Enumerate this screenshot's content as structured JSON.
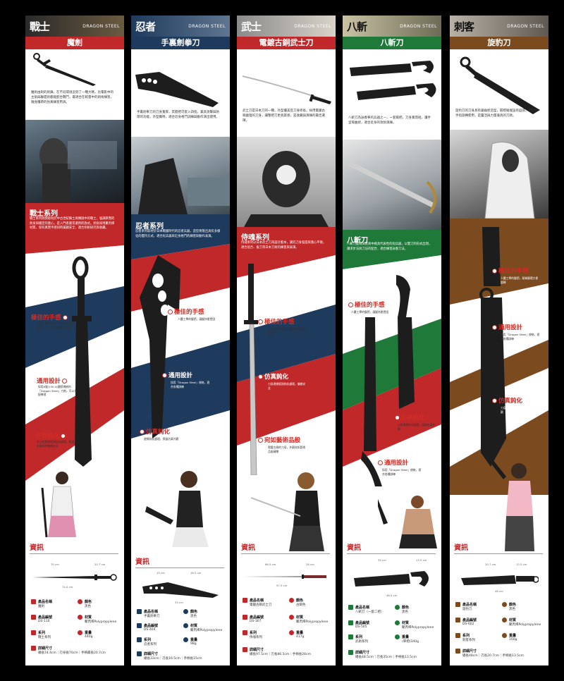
{
  "panels": [
    {
      "logo": "戰士",
      "brand": "DRAGON STEEL",
      "title": "魔劍",
      "color": "#c0282a",
      "desc": "魔劍由刺的劍鋒，在不同環境追到了一種大略，比電影中的主角與聯盟劍都能配合戰鬥，最適合在較量中的劍術練習，隨身攜帶的仿真練習用具。",
      "series": "戰士系列",
      "series_desc": "戰士系列劍款取材於中古世紀騎士與傳說中的戰士，強調厚實的劍身與穩定的重心，是入門者最常選用的款式。劍身採用聚丙烯材質，保有真實手感同時兼顧安全，適合劍術研究與收藏。",
      "features": [
        "極佳的手感",
        "通用設計",
        "仿真鈍化"
      ],
      "feature_desc": [
        "人體工學的握把，除了增強把握時的手感，更讓訓練更為舒適",
        "採用8號(130.4)國際規格的「Dragon Steel」刀劍，可以搭配練習",
        "本刀劍邊緣經過鈍化處理，保留外觀同時兼顧安全"
      ],
      "info": "資訊",
      "dims": [
        "70 cm",
        "20.7 cm",
        "74.4 cm"
      ],
      "spec_labels": [
        "產品名稱",
        "顏色",
        "產品編號",
        "材質",
        "系列",
        "重量",
        "詳細尺寸"
      ],
      "spec_values": [
        "魔劍",
        "黑色",
        "DS-110",
        "聚丙烯Polypropylene",
        "戰士系列",
        "440g",
        "總長74.4cm｜刃身長70cm｜手柄最長20.7cm"
      ]
    },
    {
      "logo": "忍者",
      "brand": "DRAGON STEEL",
      "title": "手裏劍拳刀",
      "color": "#1e3a5c",
      "desc": "手裏劍拳刀的刀身寬厚，其握把可套入四指，兼具攻擊與防禦的功能，外型獨特，適合近身格鬥訓練與動作演出使用。",
      "series": "忍者系列",
      "series_desc": "忍者系列取材於日本戰國時代的忍者兵器，造型俐落且具有多樣化的握持方式，適合短兵器與近身格鬥的練習與動作表演。",
      "features": [
        "極佳的手感",
        "通用設計",
        "仿真鈍化"
      ],
      "feature_desc": [
        "人體工學的握把，讓握持更穩固",
        "採用「Dragon Steel」規格，適合各種訓練",
        "邊緣鈍化處理，保留仿真外觀"
      ],
      "info": "資訊",
      "dims": [
        "15 cm",
        "16.5 cm",
        "33 cm"
      ],
      "spec_labels": [
        "產品名稱",
        "顏色",
        "產品編號",
        "材質",
        "系列",
        "重量",
        "詳細尺寸"
      ],
      "spec_values": [
        "手裏劍拳刀",
        "黑色",
        "DS-404",
        "聚丙烯Polypropylene",
        "忍者系列",
        "98g",
        "總長33cm｜刃長16.5cm｜手柄長15cm"
      ]
    },
    {
      "logo": "武士",
      "brand": "DRAGON STEEL",
      "title": "電鍍古銅武士刀",
      "color": "#c0282a",
      "desc": "武士刀是日本刀的一種，外型優美且刀身修長，採用電鍍古銅處理的刀身，讓整把刀更具質感，是收藏與演練的最佳選擇。",
      "series": "侍魂系列",
      "series_desc": "侍魂系列以日本武士刀為設計藍本，講究刀身弧度與重心平衡，適合居合、拔刀等日本刀術的練習與表演。",
      "features": [
        "極佳的手感",
        "仿真鈍化",
        "宛如藝術品般"
      ],
      "feature_desc": [
        "人體工學的握把，搭配纏繩手感更佳",
        "刀身邊緣經過鈍化處理，兼顧安全",
        "電鍍古銅的刀身，外觀宛如藝術品般精緻"
      ],
      "info": "資訊",
      "dims": [
        "86.5 cm",
        "26 cm",
        "97.5 cm"
      ],
      "spec_labels": [
        "產品名稱",
        "顏色",
        "產品編號",
        "材質",
        "系列",
        "重量",
        "詳細尺寸"
      ],
      "spec_values": [
        "電鍍古銅武士刀",
        "古銅色",
        "DS-307",
        "聚丙烯Polypropylene",
        "侍魂系列",
        "417g",
        "總長97.5cm｜刃長86.5cm｜手柄長26cm"
      ]
    },
    {
      "logo": "八斬",
      "brand": "DRAGON STEEL",
      "title": "八斬刀",
      "color": "#1f7a3a",
      "desc": "八斬刀為詠春拳的兵器之一，一套兩把，刀身寬而短，護手呈彎曲狀，適合近身的攻防演練。",
      "series": "八斬刀",
      "series_desc": "八斬刀是南派武術中極具代表性的短兵器，以雙刀的形式出現，講求步法與刀法的配合，適合練習詠春刀法。",
      "features": [
        "極佳的手感",
        "仿真鈍化",
        "通用設計"
      ],
      "feature_desc": [
        "人體工學的握把，讓握持更穩固",
        "刀身邊緣鈍化處理，保留仿真外觀",
        "採用「Dragon Steel」規格，適合各種訓練"
      ],
      "info": "資訊",
      "dims": [
        "35 cm",
        "13.5 cm",
        "48.5 cm"
      ],
      "spec_labels": [
        "產品名稱",
        "顏色",
        "產品編號",
        "材質",
        "系列",
        "重量",
        "詳細尺寸"
      ],
      "spec_values": [
        "八斬刀（一套二把）",
        "黑色",
        "DS-505",
        "聚丙烯Polypropylene",
        "武術系列",
        "(單把)340g",
        "總長48.5cm｜刃長35cm｜手柄長13.5cm"
      ]
    },
    {
      "logo": "刺客",
      "brand": "DRAGON STEEL",
      "title": "旋豹刀",
      "color": "#7b4a1e",
      "desc": "旋豹刀的刀身具有鋸齒狀造型，握把尾端設有圓環，可配合手指旋轉使用，是靈活與力量兼具的刀款。",
      "series": "刺客系列",
      "series_desc": "刺客系列取材於遊戲與電影中的刺客角色，兵器造型獨特，適合角色扮演與動作演出。",
      "features": [
        "極佳的手感",
        "通用設計",
        "仿真鈍化"
      ],
      "feature_desc": [
        "人體工學的握把，尾端圓環方便旋轉",
        "採用「Dragon Steel」規格，適合各種訓練",
        "刀身邊緣鈍化處理，保留仿真外觀"
      ],
      "info": "資訊",
      "dims": [
        "20.7 cm",
        "13.5 cm",
        "48 cm"
      ],
      "spec_labels": [
        "產品名稱",
        "顏色",
        "產品編號",
        "材質",
        "系列",
        "重量",
        "詳細尺寸"
      ],
      "spec_values": [
        "旋豹刀",
        "黑色",
        "DS-602",
        "聚丙烯Polypropylene",
        "刺客系列",
        "160g",
        "總長48cm｜刃長20.7cm｜手柄長13.5cm"
      ]
    }
  ]
}
